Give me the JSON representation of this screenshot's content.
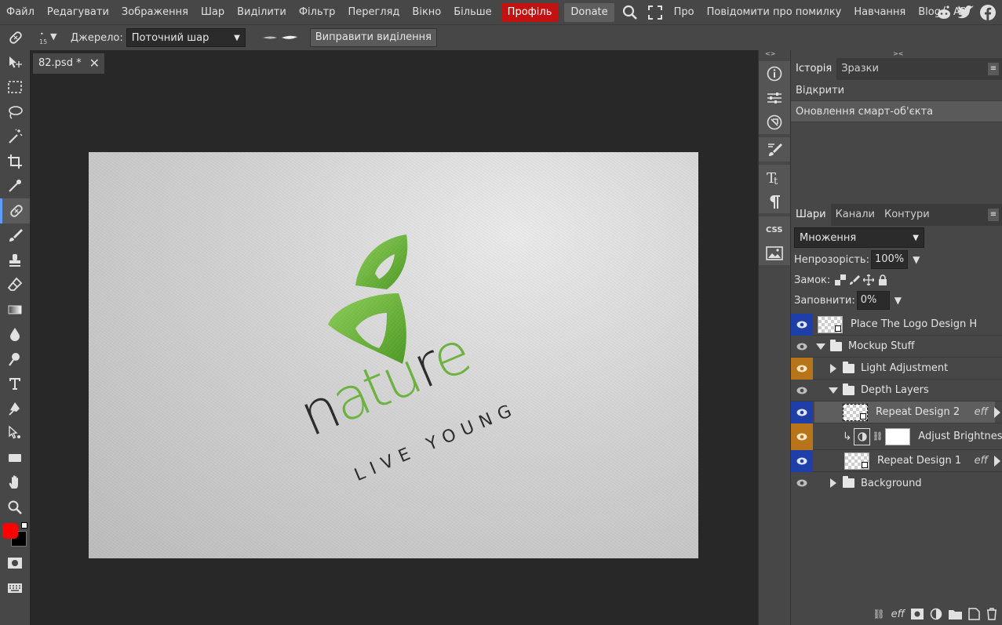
{
  "menu": {
    "items": [
      "Файл",
      "Редагувати",
      "Зображення",
      "Шар",
      "Виділити",
      "Фільтр",
      "Перегляд",
      "Вікно",
      "Більше"
    ],
    "profile": "Профіль",
    "donate": "Donate",
    "links": [
      "Про",
      "Повідомити про помилку",
      "Навчання",
      "Blog",
      "API"
    ],
    "social": [
      "reddit-icon",
      "twitter-icon",
      "facebook-icon"
    ]
  },
  "options": {
    "brush_size": "15",
    "source_label": "Джерело:",
    "source_value": "Поточний шар",
    "fix_button": "Виправити виділення"
  },
  "document": {
    "tab_title": "82.psd *",
    "logo": {
      "word": "nature",
      "tagline": "LIVE YOUNG",
      "green": "#6db33f",
      "dark": "#2a2a2a"
    }
  },
  "history_panel": {
    "tabs": [
      "Історія",
      "Зразки"
    ],
    "rows": [
      "Відкрити",
      "Оновлення смарт-об'єкта"
    ]
  },
  "layers_panel": {
    "tabs": [
      "Шари",
      "Канали",
      "Контури"
    ],
    "blend_mode": "Множення",
    "opacity_label": "Непрозорість:",
    "opacity_value": "100%",
    "lock_label": "Замок:",
    "fill_label": "Заповнити:",
    "fill_value": "0%",
    "layers": [
      {
        "name": "Place The Logo Design H",
        "eye": "blue"
      },
      {
        "name": "Mockup Stuff",
        "eye": "none"
      },
      {
        "name": "Light Adjustment",
        "eye": "orange"
      },
      {
        "name": "Depth Layers",
        "eye": "none"
      },
      {
        "name": "Repeat Design 2",
        "eye": "blue",
        "eff": "eff"
      },
      {
        "name": "Adjust Brightnes",
        "eye": "orange"
      },
      {
        "name": "Repeat Design 1",
        "eye": "blue",
        "eff": "eff"
      },
      {
        "name": "Background",
        "eye": "none"
      }
    ],
    "footer_eff": "eff"
  },
  "colors": {
    "foreground": "#ff0000",
    "background": "#000000",
    "accent": "#5e9cff",
    "profile": "#c31212"
  }
}
